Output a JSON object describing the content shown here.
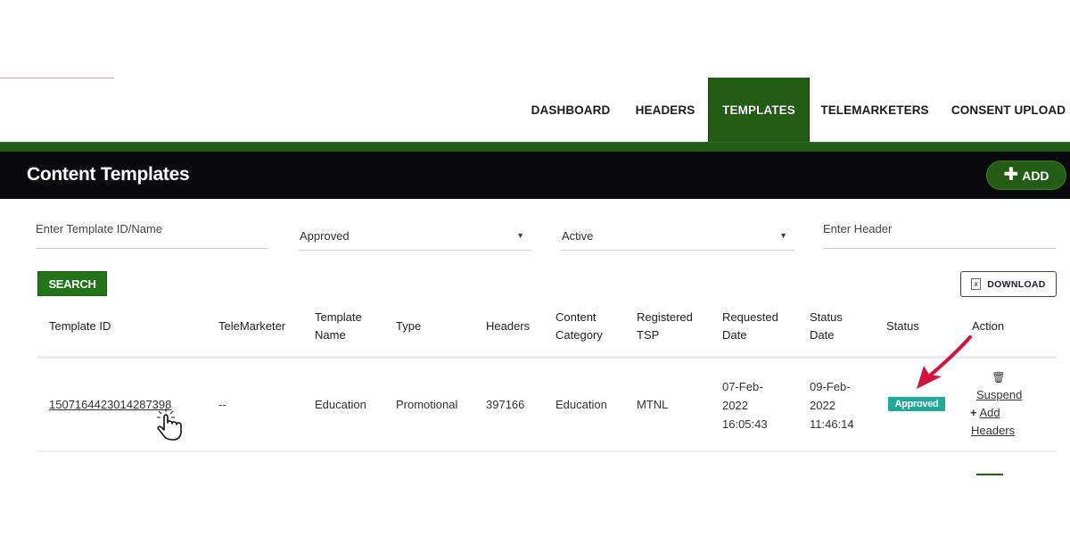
{
  "nav": {
    "items": [
      {
        "label": "DASHBOARD",
        "active": false
      },
      {
        "label": "HEADERS",
        "active": false
      },
      {
        "label": "TEMPLATES",
        "active": true
      },
      {
        "label": "TELEMARKETERS",
        "active": false
      },
      {
        "label": "CONSENT UPLOAD",
        "active": false
      }
    ]
  },
  "header": {
    "title": "Content Templates",
    "add_label": "ADD",
    "add_icon": "plus-icon"
  },
  "filters": {
    "template_id": {
      "placeholder": "Enter Template ID/Name",
      "value": ""
    },
    "approval_status": {
      "value": "Approved"
    },
    "active_status": {
      "value": "Active"
    },
    "header": {
      "placeholder": "Enter Header",
      "value": ""
    }
  },
  "toolbar": {
    "search_label": "SEARCH",
    "download_label": "DOWNLOAD",
    "download_icon": "excel-file-icon"
  },
  "table": {
    "columns": [
      {
        "line1": "Template ID",
        "line2": ""
      },
      {
        "line1": "TeleMarketer",
        "line2": ""
      },
      {
        "line1": "Template",
        "line2": "Name"
      },
      {
        "line1": "Type",
        "line2": ""
      },
      {
        "line1": "Headers",
        "line2": ""
      },
      {
        "line1": "Content",
        "line2": "Category"
      },
      {
        "line1": "Registered",
        "line2": "TSP"
      },
      {
        "line1": "Requested",
        "line2": "Date"
      },
      {
        "line1": "Status",
        "line2": "Date"
      },
      {
        "line1": "Status",
        "line2": ""
      },
      {
        "line1": "Action",
        "line2": ""
      }
    ],
    "rows": [
      {
        "template_id": "1507164423014287398",
        "telemarketer": "--",
        "template_name": "Education",
        "type": "Promotional",
        "headers": "397166",
        "content_category": "Education",
        "registered_tsp": "MTNL",
        "requested_date": {
          "date": "07-Feb-",
          "year": "2022",
          "time": "16:05:43"
        },
        "status_date": {
          "date": "09-Feb-",
          "year": "2022",
          "time": "11:46:14"
        },
        "status": "Approved",
        "actions": {
          "suspend": "Suspend",
          "add": "Add",
          "headers": "Headers"
        }
      }
    ]
  },
  "colors": {
    "brand_green": "#235c14",
    "title_bar": "#0a090c",
    "status_approved": "#20a898",
    "annotation_arrow": "#d3123f"
  }
}
